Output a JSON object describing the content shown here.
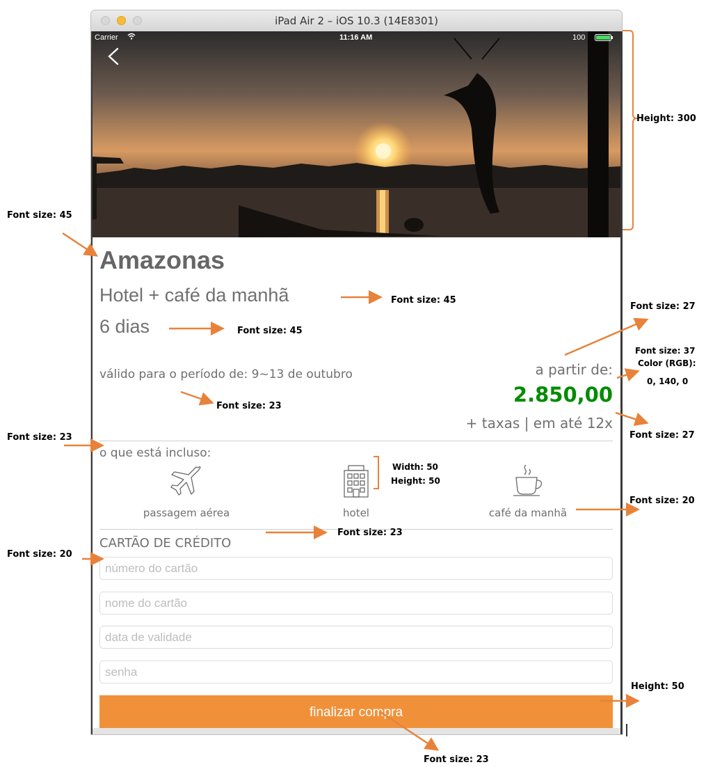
{
  "window": {
    "title": "iPad Air 2 – iOS 10.3 (14E8301)"
  },
  "status_bar": {
    "carrier": "Carrier",
    "time": "11:16 AM",
    "battery": "100"
  },
  "product": {
    "title": "Amazonas",
    "subtitle": "Hotel + café da manhã",
    "duration": "6 dias",
    "validity": "válido para o período de: 9~13 de outubro",
    "price_prefix": "a partir de:",
    "price": "2.850,00",
    "price_suffix": "+ taxas | em até 12x"
  },
  "included": {
    "heading": "o que está incluso:",
    "items": [
      {
        "label": "passagem aérea",
        "icon": "airplane-icon"
      },
      {
        "label": "hotel",
        "icon": "hotel-building-icon"
      },
      {
        "label": "café da manhã",
        "icon": "coffee-cup-icon"
      }
    ]
  },
  "credit_card": {
    "heading": "CARTÃO DE CRÉDITO",
    "fields": [
      {
        "placeholder": "número do cartão"
      },
      {
        "placeholder": "nome do cartão"
      },
      {
        "placeholder": "data de validade"
      },
      {
        "placeholder": "senha"
      }
    ],
    "submit_label": "finalizar compra"
  },
  "colors": {
    "price": "#008c00",
    "button": "#f0913a",
    "annotation": "#e8823a"
  },
  "annotations": {
    "hero_height": "Height: 300",
    "title_font": "Font size: 45",
    "subtitle_font": "Font size: 45",
    "duration_font": "Font size: 45",
    "prefix_font": "Font size: 27",
    "price_font": "Font size: 37",
    "price_color": "Color (RGB):",
    "price_color_value": "0, 140, 0",
    "validity_font": "Font size: 23",
    "suffix_font": "Font size: 27",
    "included_font": "Font size: 23",
    "icon_width": "Width: 50",
    "icon_height": "Height: 50",
    "item_font": "Font size: 20",
    "cc_heading_font": "Font size: 23",
    "field_font": "Font size: 20",
    "button_height": "Height: 50",
    "button_font": "Font size: 23"
  }
}
